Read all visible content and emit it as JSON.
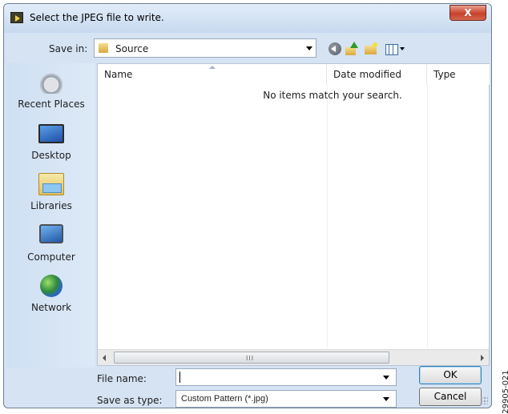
{
  "window": {
    "title": "Select the JPEG file to write.",
    "close_glyph": "X"
  },
  "save_in": {
    "label": "Save in:",
    "value": "Source"
  },
  "places": [
    {
      "label": "Recent Places",
      "icon": "recent-places-icon"
    },
    {
      "label": "Desktop",
      "icon": "desktop-icon"
    },
    {
      "label": "Libraries",
      "icon": "libraries-icon"
    },
    {
      "label": "Computer",
      "icon": "computer-icon"
    },
    {
      "label": "Network",
      "icon": "network-icon"
    }
  ],
  "file_list": {
    "columns": [
      "Name",
      "Date modified",
      "Type"
    ],
    "empty_message": "No items match your search.",
    "scroll_grip": "III"
  },
  "file_name": {
    "label": "File name:",
    "value": ""
  },
  "save_as_type": {
    "label": "Save as type:",
    "value": "Custom Pattern (*.jpg)"
  },
  "buttons": {
    "ok": "OK",
    "cancel": "Cancel"
  },
  "figure_id": "29905-021"
}
